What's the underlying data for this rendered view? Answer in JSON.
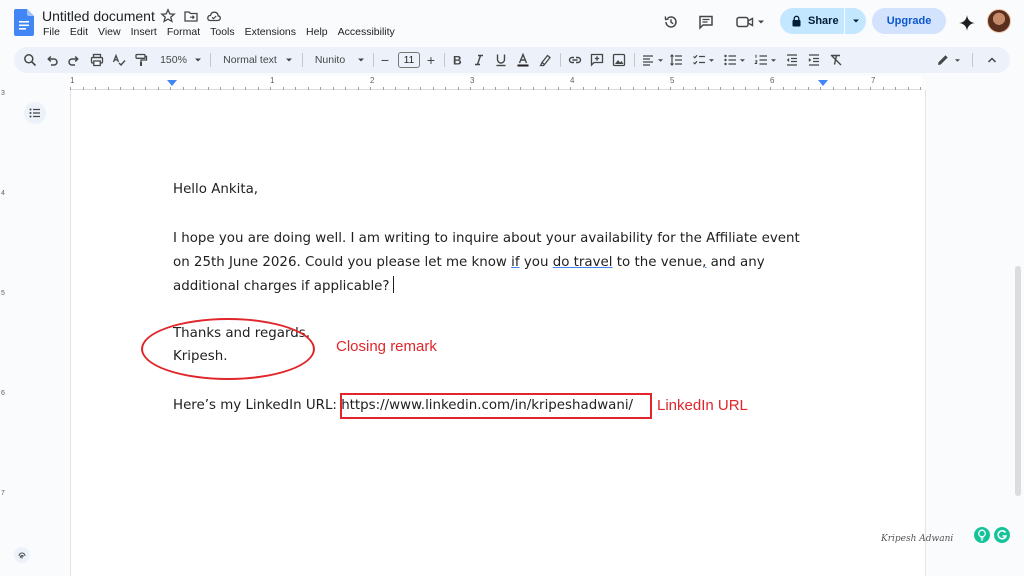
{
  "document": {
    "title": "Untitled document"
  },
  "menu": [
    "File",
    "Edit",
    "View",
    "Insert",
    "Format",
    "Tools",
    "Extensions",
    "Help",
    "Accessibility"
  ],
  "header": {
    "share_label": "Share",
    "upgrade_label": "Upgrade"
  },
  "toolbar": {
    "zoom": "150%",
    "style": "Normal text",
    "font": "Nunito",
    "font_size": "11",
    "minus": "−",
    "plus": "+"
  },
  "ruler": {
    "numbers": [
      "1",
      "1",
      "2",
      "3",
      "4",
      "5",
      "6",
      "7"
    ],
    "vertical_numbers": [
      "3",
      "4",
      "5",
      "6",
      "7"
    ]
  },
  "body": {
    "greeting": "Hello Ankita,",
    "para_line1": "I hope you are doing well. I am writing to inquire about your availability for the Affiliate event",
    "para_line2_a": "on 25th June 2026. Could you please let me know ",
    "para_line2_if": "if",
    "para_line2_b": " you ",
    "para_line2_do_travel": "do travel",
    "para_line2_c": " to the venue",
    "para_line2_comma": ",",
    "para_line2_d": " and any",
    "para_line3": "additional charges if applicable?",
    "closing_line1": "Thanks and regards,",
    "closing_line2": "Kripesh.",
    "linkedin_prefix": "Here’s my LinkedIn URL: ",
    "linkedin_url": "https://www.linkedin.com/in/kripeshadwani/"
  },
  "annotations": {
    "closing_label": "Closing remark",
    "linkedin_label": "LinkedIn URL",
    "color": "#e0262a"
  },
  "watermark": {
    "signature": "Kripesh Adwani"
  },
  "colors": {
    "accent": "#0b57d0",
    "share_bg": "#c2e7ff",
    "toolbar_bg": "#edf2fa",
    "doc_icon": "#4285f4"
  }
}
